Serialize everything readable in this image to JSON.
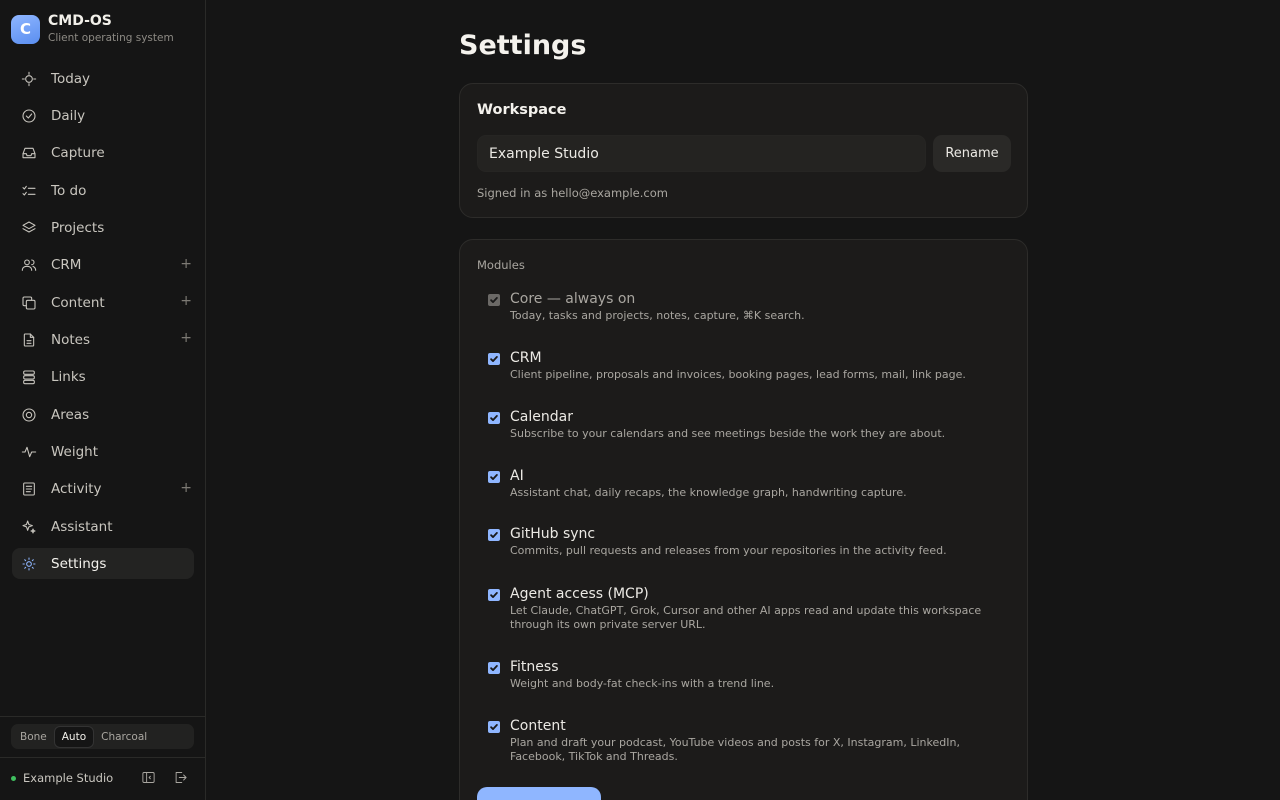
{
  "brand": {
    "initial": "C",
    "title": "CMD-OS",
    "subtitle": "Client operating system"
  },
  "nav": [
    {
      "label": "Today",
      "icon": "sun-icon",
      "plus": false
    },
    {
      "label": "Daily",
      "icon": "check-circle-icon",
      "plus": false
    },
    {
      "label": "Capture",
      "icon": "inbox-icon",
      "plus": false
    },
    {
      "label": "To do",
      "icon": "list-check-icon",
      "plus": false
    },
    {
      "label": "Projects",
      "icon": "layers-icon",
      "plus": false
    },
    {
      "label": "CRM",
      "icon": "users-icon",
      "plus": true
    },
    {
      "label": "Content",
      "icon": "copy-icon",
      "plus": true
    },
    {
      "label": "Notes",
      "icon": "file-text-icon",
      "plus": true
    },
    {
      "label": "Links",
      "icon": "database-icon",
      "plus": false
    },
    {
      "label": "Areas",
      "icon": "target-icon",
      "plus": false
    },
    {
      "label": "Weight",
      "icon": "activity-pulse-icon",
      "plus": false
    },
    {
      "label": "Activity",
      "icon": "document-icon",
      "plus": true
    },
    {
      "label": "Assistant",
      "icon": "sparkles-icon",
      "plus": false
    },
    {
      "label": "Settings",
      "icon": "settings-sun-icon",
      "plus": false,
      "active": true
    }
  ],
  "plus_symbol": "+",
  "theme": {
    "options": [
      "Bone",
      "Auto",
      "Charcoal"
    ],
    "selected": "Auto"
  },
  "footer": {
    "workspace": "Example Studio",
    "status_color": "#3fbf5f"
  },
  "page": {
    "title": "Settings"
  },
  "workspace": {
    "title": "Workspace",
    "name_value": "Example Studio",
    "rename_label": "Rename",
    "signed_in": "Signed in as hello@example.com"
  },
  "modules": {
    "heading": "Modules",
    "items": [
      {
        "name": "Core — always on",
        "desc": "Today, tasks and projects, notes, capture, ⌘K search.",
        "checked": true,
        "disabled": true
      },
      {
        "name": "CRM",
        "desc": "Client pipeline, proposals and invoices, booking pages, lead forms, mail, link page.",
        "checked": true
      },
      {
        "name": "Calendar",
        "desc": "Subscribe to your calendars and see meetings beside the work they are about.",
        "checked": true
      },
      {
        "name": "AI",
        "desc": "Assistant chat, daily recaps, the knowledge graph, handwriting capture.",
        "checked": true
      },
      {
        "name": "GitHub sync",
        "desc": "Commits, pull requests and releases from your repositories in the activity feed.",
        "checked": true
      },
      {
        "name": "Agent access (MCP)",
        "desc": "Let Claude, ChatGPT, Grok, Cursor and other AI apps read and update this workspace through its own private server URL.",
        "checked": true
      },
      {
        "name": "Fitness",
        "desc": "Weight and body-fat check-ins with a trend line.",
        "checked": true
      },
      {
        "name": "Content",
        "desc": "Plan and draft your podcast, YouTube videos and posts for X, Instagram, LinkedIn, Facebook, TikTok and Threads.",
        "checked": true
      }
    ]
  },
  "colors": {
    "accent": "#8fb6ff",
    "background": "#151515",
    "card": "#1c1b1a"
  }
}
